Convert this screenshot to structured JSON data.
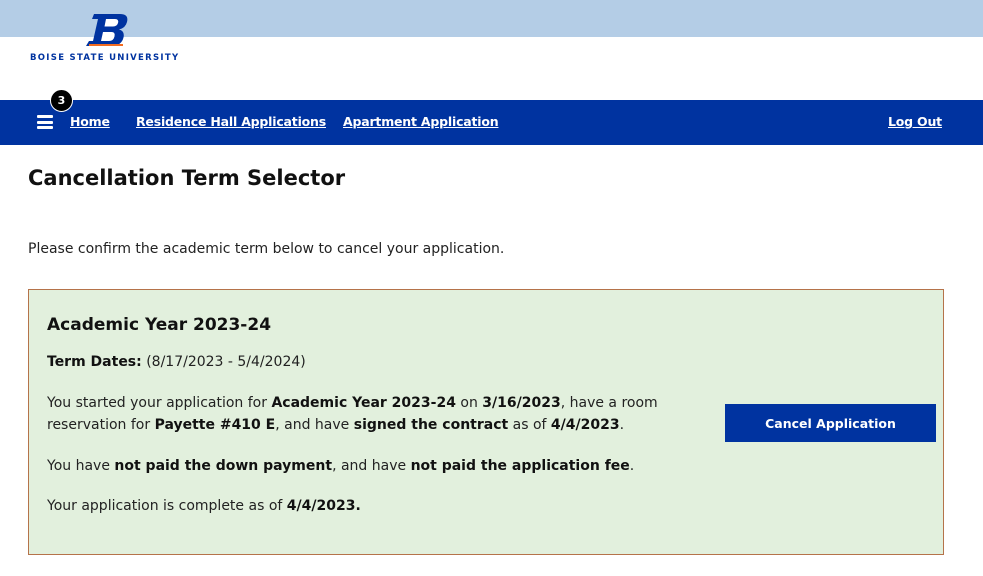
{
  "brand": {
    "name": "BOISE STATE UNIVERSITY",
    "logo_letter": "B",
    "primary_color": "#0033a0",
    "banner_color": "#b4cde6"
  },
  "nav": {
    "menu_icon": "hamburger-menu-icon",
    "notification_count": "3",
    "home": "Home",
    "residence_hall": "Residence Hall Applications",
    "apartment": "Apartment Application",
    "logout": "Log Out"
  },
  "page": {
    "title": "Cancellation Term Selector",
    "instructions": "Please confirm the academic term below to cancel your application."
  },
  "term": {
    "title": "Academic Year 2023-24",
    "dates_label": "Term Dates:",
    "dates_value": "(8/17/2023 - 5/4/2024)",
    "line1": {
      "p1": "You started your application for ",
      "term": "Academic Year 2023-24",
      "p2": " on ",
      "start_date": "3/16/2023",
      "p3": ", have a room"
    },
    "line2": {
      "p1": "reservation for ",
      "room": "Payette #410 E",
      "p2": ", and have ",
      "contract": "signed the contract",
      "p3": " as of ",
      "contract_date": "4/4/2023",
      "p4": "."
    },
    "line3": {
      "p1": "You have ",
      "down_payment": "not paid the down payment",
      "p2": ", and have ",
      "app_fee": "not paid the application fee",
      "p3": "."
    },
    "line4": {
      "p1": "Your application is complete as of ",
      "complete_date": "4/4/2023."
    },
    "card_background": "#e2f0dd",
    "card_border": "#b5734a",
    "cancel_button": "Cancel Application"
  }
}
